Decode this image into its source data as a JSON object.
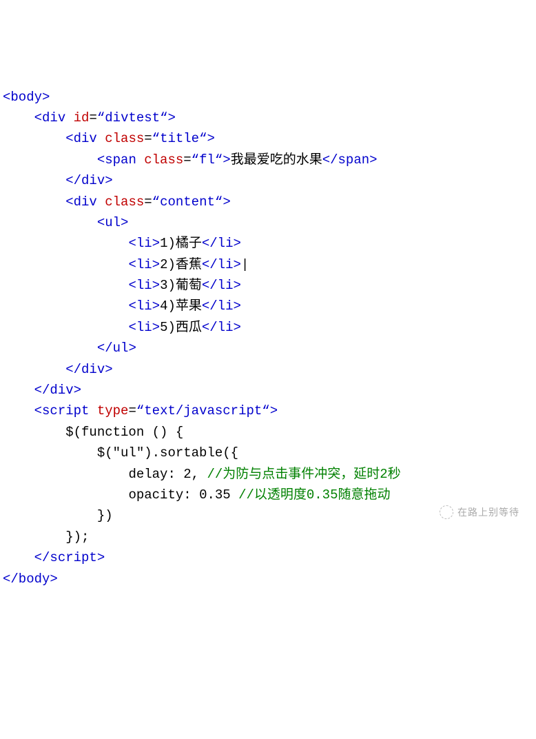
{
  "code": {
    "body_open": "body",
    "body_close": "/body",
    "div_open": "div",
    "div_close": "/div",
    "span_open": "span",
    "span_close": "/span",
    "ul_open": "ul",
    "ul_close": "/ul",
    "li_open": "li",
    "li_close": "/li",
    "script_open": "script",
    "script_close": "/script",
    "attr_id": "id",
    "attr_class": "class",
    "attr_type": "type",
    "val_divtest": "divtest",
    "val_title": "title",
    "val_fl": "fl",
    "val_content": "content",
    "val_textjs": "text/javascript",
    "title_text": "我最爱吃的水果",
    "items": {
      "i1": "1)橘子",
      "i2": "2)香蕉",
      "i3": "3)葡萄",
      "i4": "4)苹果",
      "i5": "5)西瓜"
    },
    "js": {
      "line1": "$(function () {",
      "line2": "$(\"ul\").sortable({",
      "line3a": "delay:",
      "line3b": "2,",
      "line3c": "//为防与点击事件冲突，延时2秒",
      "line4a": "opacity:",
      "line4b": "0.35",
      "line4c": "//以透明度0.35随意拖动",
      "line5": "})",
      "line6": "});"
    }
  },
  "watermark": "在路上别等待",
  "quote_open": "“",
  "quote_close": "“",
  "lt": "<",
  "gt": ">",
  "eq": "=",
  "cursor": "|"
}
